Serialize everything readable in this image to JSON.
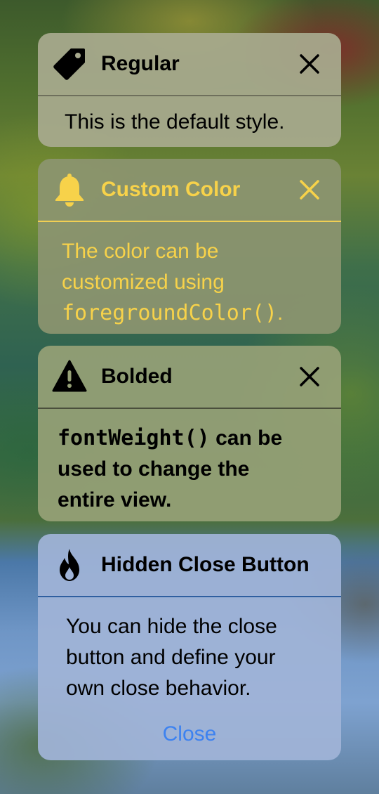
{
  "colors": {
    "custom_accent": "#F7D24A",
    "link_blue": "#3D82F0"
  },
  "cards": {
    "regular": {
      "icon": "tag-icon",
      "title": "Regular",
      "body": "This is the default style."
    },
    "custom_color": {
      "icon": "bell-icon",
      "title": "Custom Color",
      "body_line1": "The color can be",
      "body_line2": "customized using",
      "body_code": "foregroundColor()",
      "body_end": "."
    },
    "bolded": {
      "icon": "warning-triangle-icon",
      "title": "Bolded",
      "body_code": "fontWeight()",
      "body_rest1": " can be",
      "body_line2": "used to change the",
      "body_line3": "entire view."
    },
    "hidden_close": {
      "icon": "flame-icon",
      "title": "Hidden Close Button",
      "body_line1": "You can hide the close",
      "body_line2": "button and define your",
      "body_line3": "own close behavior.",
      "close_label": "Close"
    }
  }
}
